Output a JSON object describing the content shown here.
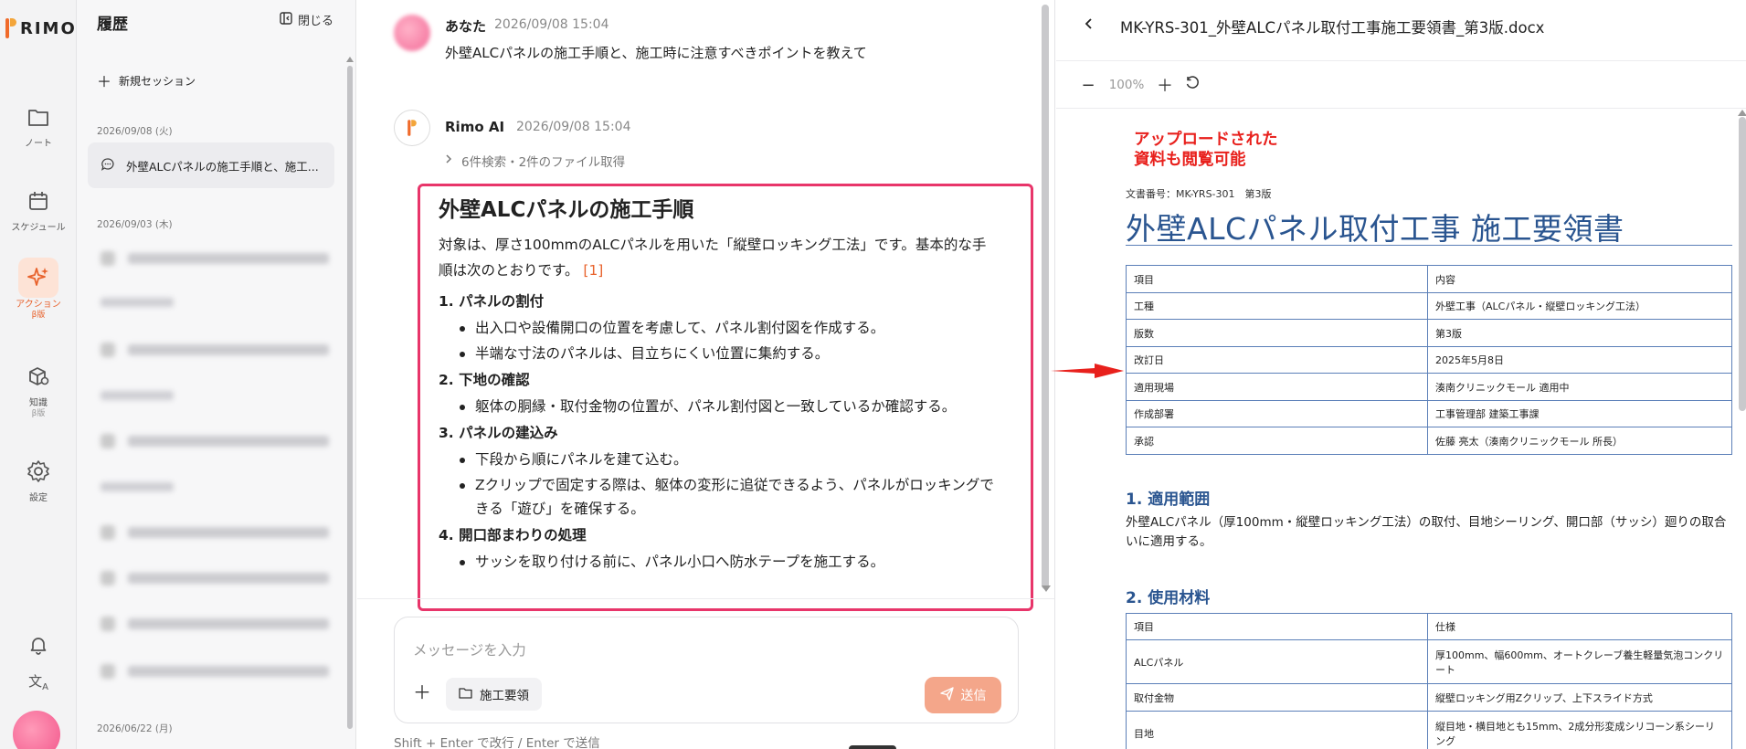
{
  "brand": {
    "name": "RIMO",
    "accent": "#e8622c",
    "highlight": "#e8356a"
  },
  "rail": {
    "items": [
      {
        "label": "ノート",
        "sub": "",
        "icon": "folder-icon"
      },
      {
        "label": "スケジュール",
        "sub": "",
        "icon": "calendar-icon"
      },
      {
        "label": "アクション",
        "sub": "β版",
        "icon": "sparkle-icon"
      },
      {
        "label": "知識",
        "sub": "β版",
        "icon": "knowledge-box-icon"
      },
      {
        "label": "設定",
        "sub": "",
        "icon": "gear-icon"
      }
    ]
  },
  "history": {
    "title": "履歴",
    "close_label": "閉じる",
    "new_session_label": "新規セッション",
    "groups": [
      {
        "date": "2026/09/08 (火)",
        "items": [
          "外壁ALCパネルの施工手順と、施工..."
        ]
      },
      {
        "date": "2026/09/03 (木)",
        "items": []
      },
      {
        "date": "2026/06/22 (月)",
        "items": []
      }
    ]
  },
  "chat": {
    "user": {
      "name": "あなた",
      "time": "2026/09/08 15:04",
      "text": "外壁ALCパネルの施工手順と、施工時に注意すべきポイントを教えて"
    },
    "ai": {
      "name": "Rimo AI",
      "time": "2026/09/08 15:04",
      "tool_summary": "6件検索・2件のファイル取得"
    },
    "answer": {
      "heading": "外壁ALCパネルの施工手順",
      "intro": "対象は、厚さ100mmのALCパネルを用いた「縦壁ロッキング工法」です。基本的な手順は次のとおりです。",
      "ref": "[1]",
      "steps": [
        {
          "title": "1. パネルの割付",
          "bullets": [
            "出入口や設備開口の位置を考慮して、パネル割付図を作成する。",
            "半端な寸法のパネルは、目立ちにくい位置に集約する。"
          ]
        },
        {
          "title": "2. 下地の確認",
          "bullets": [
            "躯体の胴縁・取付金物の位置が、パネル割付図と一致しているか確認する。"
          ]
        },
        {
          "title": "3. パネルの建込み",
          "bullets": [
            "下段から順にパネルを建て込む。",
            "Zクリップで固定する際は、躯体の変形に追従できるよう、パネルがロッキングできる「遊び」を確保する。"
          ]
        },
        {
          "title": "4. 開口部まわりの処理",
          "bullets": [
            "サッシを取り付ける前に、パネル小口へ防水テープを施工する。"
          ]
        }
      ]
    },
    "input": {
      "placeholder": "メッセージを入力",
      "folder_chip": "施工要領",
      "send_label": "送信",
      "hint": "Shift + Enter で改行 / Enter で送信"
    }
  },
  "viewer": {
    "file_name": "MK-YRS-301_外壁ALCパネル取付工事施工要領書_第3版.docx",
    "zoom": "100%",
    "annotation": "アップロードされた\n資料も閲覧可能",
    "doc": {
      "doc_no": "文書番号：MK-YRS-301　第3版",
      "title": "外壁ALCパネル取付工事 施工要領書",
      "info_table": [
        [
          "項目",
          "内容"
        ],
        [
          "工種",
          "外壁工事（ALCパネル・縦壁ロッキング工法）"
        ],
        [
          "版数",
          "第3版"
        ],
        [
          "改訂日",
          "2025年5月8日"
        ],
        [
          "適用現場",
          "湊南クリニックモール 適用中"
        ],
        [
          "作成部署",
          "工事管理部 建築工事課"
        ],
        [
          "承認",
          "佐藤 亮太（湊南クリニックモール 所長）"
        ]
      ],
      "section1_title": "1. 適用範囲",
      "section1_text": "外壁ALCパネル（厚100mm・縦壁ロッキング工法）の取付、目地シーリング、開口部（サッシ）廻りの取合いに適用する。",
      "section2_title": "2. 使用材料",
      "material_table": [
        [
          "項目",
          "仕様"
        ],
        [
          "ALCパネル",
          "厚100mm、幅600mm、オートクレーブ養生軽量気泡コンクリート"
        ],
        [
          "取付金物",
          "縦壁ロッキング用Zクリップ、上下スライド方式"
        ],
        [
          "目地",
          "縦目地・横目地とも15mm、2成分形変成シリコーン系シーリング"
        ]
      ]
    }
  }
}
